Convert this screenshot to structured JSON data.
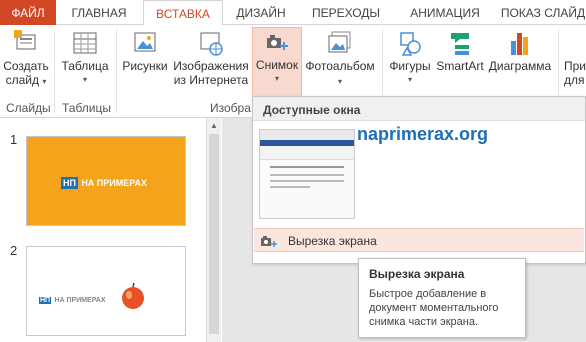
{
  "tabs": {
    "file": "ФАЙЛ",
    "home": "ГЛАВНАЯ",
    "insert": "ВСТАВКА",
    "design": "ДИЗАЙН",
    "transitions": "ПЕРЕХОДЫ",
    "animation": "АНИМАЦИЯ",
    "slideshow": "ПОКАЗ СЛАЙД"
  },
  "ribbon": {
    "new_slide": [
      "Создать",
      "слайд"
    ],
    "table": "Таблица",
    "pictures": "Рисунки",
    "online_pictures": [
      "Изображения",
      "из Интернета"
    ],
    "screenshot": "Снимок",
    "photo_album": "Фотоальбом",
    "shapes": "Фигуры",
    "smartart": "SmartArt",
    "chart": "Диаграмма",
    "apps": [
      "При",
      "для"
    ],
    "groups": {
      "slides": "Слайды",
      "tables": "Таблицы",
      "images": "Изобра"
    }
  },
  "slides": {
    "numbers": [
      "1",
      "2"
    ],
    "logo_text": "НА ПРИМЕРАХ",
    "logo_abbr": "НП"
  },
  "dropdown": {
    "header": "Доступные окна",
    "clipping": "Вырезка экрана"
  },
  "watermark": "naprimerax.org",
  "tooltip": {
    "title": "Вырезка экрана",
    "body": "Быстрое добавление в документ моментального снимка части экрана."
  },
  "colors": {
    "accent": "#d24726",
    "slide1_bg": "#f5a31a",
    "hover": "#fbe6df"
  }
}
